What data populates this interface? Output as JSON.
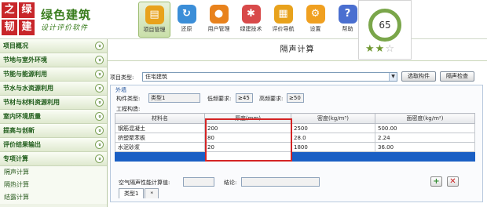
{
  "brand": {
    "logo_chars": [
      "之",
      "绿",
      "韧",
      "建"
    ],
    "title": "绿色建筑",
    "subtitle": "设计评价软件"
  },
  "nav": [
    {
      "label": "项目管理",
      "icon": "folder-icon",
      "color": "#e8a21c",
      "glyph": "▤",
      "active": true
    },
    {
      "label": "还原",
      "icon": "restore-icon",
      "color": "#3b8ed8",
      "glyph": "↻",
      "active": false
    },
    {
      "label": "用户管理",
      "icon": "user-icon",
      "color": "#e8821c",
      "glyph": "●",
      "active": false
    },
    {
      "label": "绿建技术",
      "icon": "tech-icon",
      "color": "#d84a4a",
      "glyph": "✱",
      "active": false
    },
    {
      "label": "评价导航",
      "icon": "navigation-icon",
      "color": "#e8a21c",
      "glyph": "▦",
      "active": false
    },
    {
      "label": "设置",
      "icon": "gear-icon",
      "color": "#f0a020",
      "glyph": "⚙",
      "active": false
    },
    {
      "label": "帮助",
      "icon": "help-icon",
      "color": "#4a6fd0",
      "glyph": "?",
      "active": false
    }
  ],
  "score": {
    "value": "65",
    "stars_filled": 2,
    "stars_total": 3
  },
  "sidebar": {
    "sections": [
      {
        "label": "项目概况"
      },
      {
        "label": "节地与室外环境"
      },
      {
        "label": "节能与能源利用"
      },
      {
        "label": "节水与水资源利用"
      },
      {
        "label": "节材与材料资源利用"
      },
      {
        "label": "室内环境质量"
      },
      {
        "label": "提高与创新"
      },
      {
        "label": "评价结果输出"
      },
      {
        "label": "专项计算"
      }
    ],
    "sub_items": [
      {
        "label": "隔声计算"
      },
      {
        "label": "隔热计算"
      },
      {
        "label": "结露计算"
      }
    ]
  },
  "page_title": "隔声计算",
  "project_type": {
    "label": "项目类型:",
    "value": "住宅建筑"
  },
  "buttons": {
    "choose_component": "选取构件",
    "sound_check": "隔声检查"
  },
  "group": {
    "title": "外墙",
    "component_type_label": "构件类型:",
    "component_type_value": "类型1",
    "low_freq_label": "低频要求:",
    "low_freq_value": "≥45",
    "high_freq_label": "高频要求:",
    "high_freq_value": "≥50",
    "structure_label": "工程构造:"
  },
  "table": {
    "headers": [
      "材料名",
      "厚度(mm)",
      "密度(kg/m³)",
      "面密度(kg/m²)"
    ],
    "rows": [
      [
        "钢筋混凝土",
        "200",
        "2500",
        "500.00"
      ],
      [
        "挤塑聚苯板",
        "80",
        "28.0",
        "2.24"
      ],
      [
        "水泥砂浆",
        "20",
        "1800",
        "36.00"
      ]
    ]
  },
  "calc": {
    "label": "空气隔声性能计算值:",
    "value": "",
    "conclusion_label": "结论:",
    "conclusion_value": ""
  },
  "tabs": [
    {
      "label": "类型1"
    },
    {
      "label": "*"
    }
  ]
}
